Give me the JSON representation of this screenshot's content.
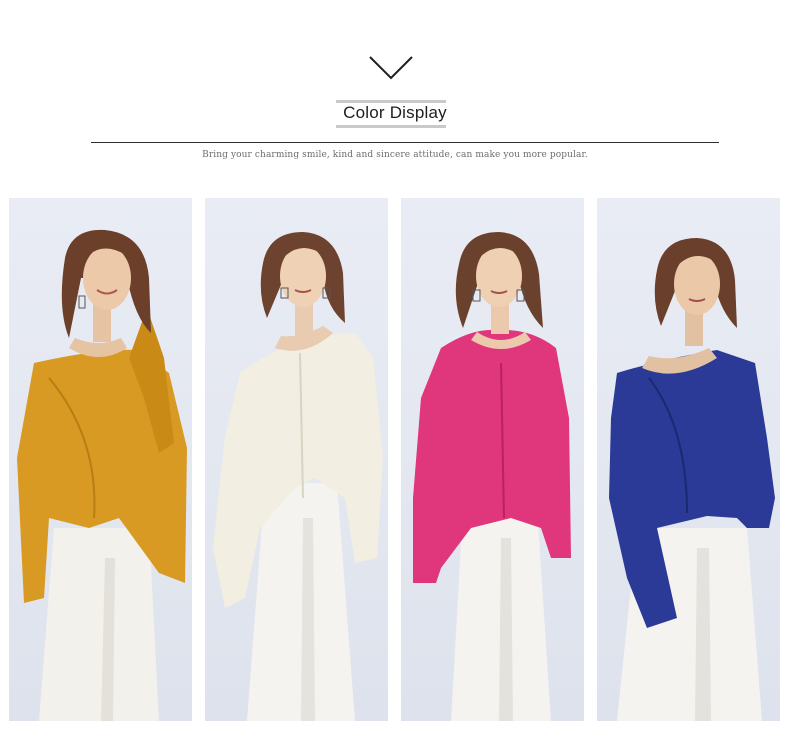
{
  "header": {
    "title": "Color Display",
    "subtitle": "Bring your charming smile, kind and sincere attitude, can make you more popular.",
    "chevron_icon": "chevron-down-icon"
  },
  "gallery": {
    "photos": [
      {
        "color_name": "mustard",
        "sweater": "#d89a22",
        "shade": "#b77e12"
      },
      {
        "color_name": "cream",
        "sweater": "#f2efe2",
        "shade": "#d9d4c1"
      },
      {
        "color_name": "rose",
        "sweater": "#e0367c",
        "shade": "#b8225e"
      },
      {
        "color_name": "royal-blue",
        "sweater": "#2a3a96",
        "shade": "#1c2870"
      }
    ]
  }
}
